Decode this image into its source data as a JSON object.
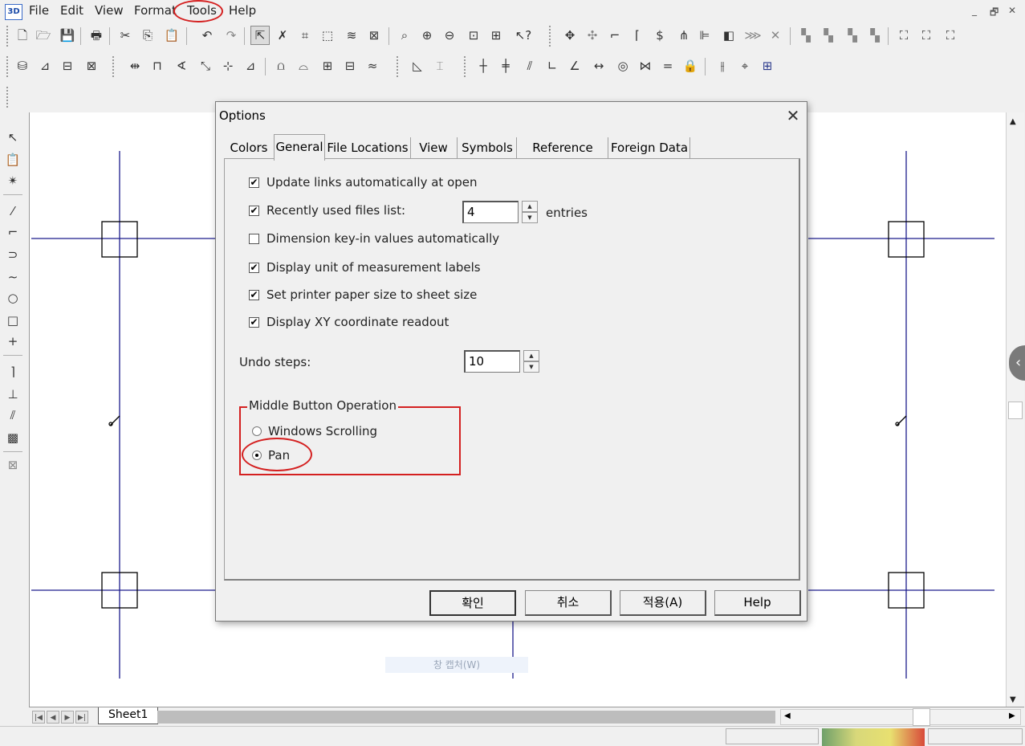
{
  "app": {
    "icon_text": "3D",
    "menu": [
      "File",
      "Edit",
      "View",
      "Format",
      "Tools",
      "Help"
    ],
    "window_controls": [
      "_",
      "🗗",
      "✕"
    ]
  },
  "toolbar1": {
    "icons": [
      "new-icon",
      "open-icon",
      "save-icon",
      "print-icon",
      "cut-icon",
      "copy-icon",
      "paste-icon",
      "undo-icon",
      "redo-icon",
      "select-tool-icon",
      "delete-segment-icon",
      "break-icon",
      "select-all-icon",
      "layers-icon",
      "image-icon",
      "zoom-area-icon",
      "zoom-in-icon",
      "zoom-out-icon",
      "fit-icon",
      "zoom-window-icon",
      "help-pointer-icon",
      "move-icon",
      "copy-move-icon",
      "fillet-icon",
      "offset-fillet-icon",
      "spiral-icon",
      "mirror-icon",
      "align-icon",
      "fill-icon",
      "hatch-icon",
      "erase-icon",
      "group-icon",
      "ungroup-icon",
      "front-icon",
      "back-icon",
      "frame-icon",
      "frame2-icon",
      "frame3-icon"
    ]
  },
  "toolbar2": {
    "icons": [
      "beam-icon",
      "column-icon",
      "wall-icon",
      "slab-icon",
      "dim-linear-icon",
      "dim-aligned-icon",
      "dim-angle-icon",
      "dim-radius-icon",
      "dim-point-icon",
      "dim-stack-icon",
      "label-icon",
      "label2-icon",
      "table-icon",
      "table2-icon",
      "wave-icon",
      "shade-icon",
      "text-edit-icon",
      "perpendicular-icon",
      "midpoint-icon",
      "parallel-icon",
      "corner-icon",
      "angle-icon",
      "distance-icon",
      "concentric-icon",
      "symmetric-icon",
      "equal-icon",
      "lock-icon",
      "constraint-icon",
      "snap-icon",
      "grid-icon"
    ]
  },
  "lefttoolbar": {
    "icons": [
      "arrow-select-icon",
      "clipboard-icon",
      "magic-select-icon",
      "line-icon",
      "polyline-icon",
      "arc-icon",
      "curve-icon",
      "circle-icon",
      "rectangle-icon",
      "point-icon",
      "fillet-tool-icon",
      "trim-icon",
      "extend-icon",
      "hatch-tool-icon",
      "symbol-tool-icon"
    ]
  },
  "sheet": {
    "nav": [
      "|◀",
      "◀",
      "▶",
      "▶|"
    ],
    "tab": "Sheet1"
  },
  "watermark": "창 캡처(W)",
  "dialog": {
    "title": "Options",
    "close": "✕",
    "tabs": [
      "Colors",
      "General",
      "File Locations",
      "View",
      "Symbols",
      "Reference Files",
      "Foreign Data"
    ],
    "active_tab": "General",
    "checkboxes": [
      {
        "label": "Update links automatically at open",
        "checked": true
      },
      {
        "label": "Recently used files list:",
        "checked": true
      },
      {
        "label": "Dimension key-in values automatically",
        "checked": false
      },
      {
        "label": "Display unit of measurement labels",
        "checked": true
      },
      {
        "label": "Set printer paper size to sheet size",
        "checked": true
      },
      {
        "label": "Display XY coordinate readout",
        "checked": true
      }
    ],
    "recent_files_value": "4",
    "recent_files_unit": "entries",
    "undo_label": "Undo steps:",
    "undo_value": "10",
    "middle_button": {
      "title": "Middle Button Operation",
      "options": [
        {
          "label": "Windows Scrolling",
          "selected": false
        },
        {
          "label": "Pan",
          "selected": true
        }
      ]
    },
    "buttons": {
      "ok": "확인",
      "cancel": "취소",
      "apply": "적용(A)",
      "help": "Help"
    }
  },
  "colors": {
    "annotation_red": "#d42020",
    "drawing_line": "#1c1c8c"
  }
}
